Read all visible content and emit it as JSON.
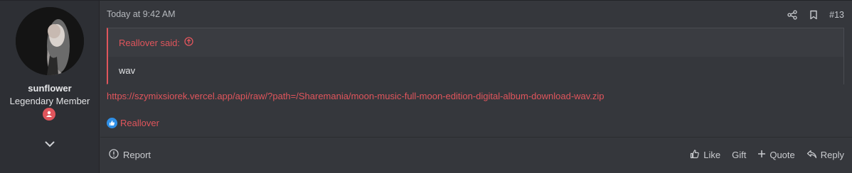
{
  "user": {
    "username": "sunflower",
    "title": "Legendary Member",
    "avatar_icon": "user-avatar-photo",
    "badge_icon": "user-badge-icon",
    "badge_color": "#e0555c"
  },
  "post": {
    "date": "Today at 9:42 AM",
    "number": "#13",
    "top_icons": [
      "share-icon",
      "bookmark-icon"
    ]
  },
  "quote": {
    "author_label": "Reallover said:",
    "text": "wav"
  },
  "link": {
    "text": "https://szymixsiorek.vercel.app/api/raw/?path=/Sharemania/moon-music-full-moon-edition-digital-album-download-wav.zip"
  },
  "reactions": {
    "users": "Reallover"
  },
  "footer": {
    "report": "Report",
    "like": "Like",
    "gift": "Gift",
    "quote": "Quote",
    "reply": "Reply"
  },
  "colors": {
    "accent": "#e0555c",
    "background": "#35373c",
    "sidebar": "#2d2f34",
    "like_blue": "#2f8fe6"
  }
}
